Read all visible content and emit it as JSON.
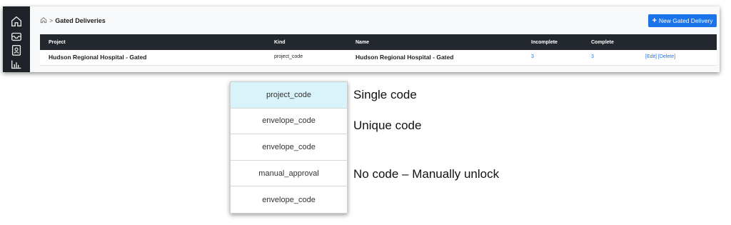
{
  "sidebar": {
    "icons": [
      "home-icon",
      "inbox-icon",
      "contact-card-icon",
      "bar-chart-icon"
    ]
  },
  "breadcrumb": {
    "separator": ">",
    "current": "Gated Deliveries"
  },
  "toolbar": {
    "new_button_icon": "+",
    "new_button_label": "New Gated Delivery"
  },
  "table": {
    "headers": [
      "Project",
      "Kind",
      "Name",
      "Incomplete",
      "Complete"
    ],
    "rows": [
      {
        "project": "Hudson Regional Hospital  - Gated",
        "kind": "project_code",
        "name": "Hudson Regional Hospital  - Gated",
        "incomplete": "3",
        "complete": "3",
        "edit": "[Edit]",
        "delete": "[Delete]"
      }
    ]
  },
  "kind_options": [
    {
      "label": "project_code",
      "selected": true
    },
    {
      "label": "envelope_code",
      "selected": false
    },
    {
      "label": "envelope_code",
      "selected": false
    },
    {
      "label": "manual_approval",
      "selected": false
    },
    {
      "label": "envelope_code",
      "selected": false
    }
  ],
  "annotations": {
    "single": "Single code",
    "unique": "Unique code",
    "manual": "No code – Manually unlock"
  },
  "colors": {
    "sidebar_bg": "#1f2329",
    "header_bg": "#23272e",
    "accent": "#1a73e8",
    "selected_bg": "#d8f3f9"
  }
}
